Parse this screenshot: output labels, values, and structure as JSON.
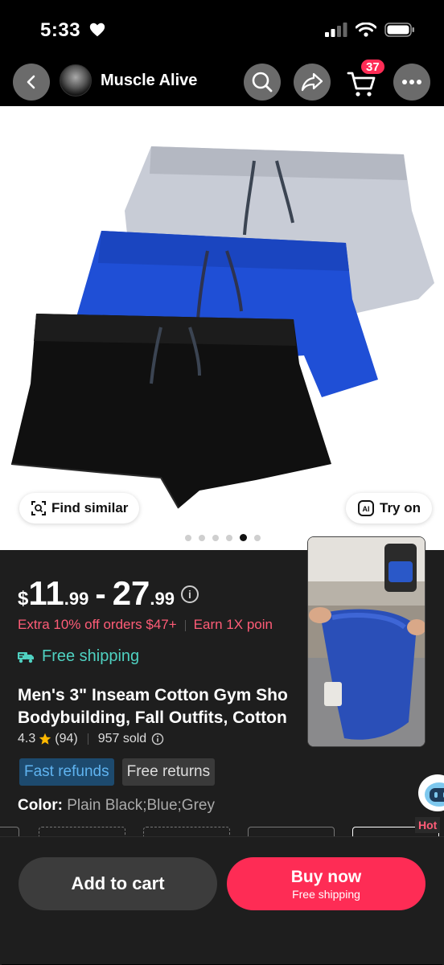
{
  "status_bar": {
    "time": "5:33"
  },
  "nav": {
    "shop_name": "Muscle Alive",
    "cart_count": "37"
  },
  "hero": {
    "find_similar": "Find similar",
    "try_on": "Try on",
    "carousel": {
      "total": 6,
      "active_index": 4
    }
  },
  "product": {
    "price": {
      "currency": "$",
      "low_main": "11",
      "low_cents": ".99",
      "dash": "-",
      "high_main": "27",
      "high_cents": ".99"
    },
    "promo": "Extra 10% off orders $47+",
    "points": "Earn 1X poin",
    "shipping": "Free shipping",
    "title_line1": "Men's 3\" Inseam Cotton Gym Sho",
    "title_line2": "Bodybuilding, Fall Outfits, Cotton",
    "rating": "4.3",
    "reviews": "(94)",
    "sold": "957 sold",
    "badges": [
      "Fast refunds",
      "Free returns"
    ],
    "color_label": "Color:",
    "color_value": "Plain Black;Blue;Grey"
  },
  "floating": {
    "hot_label": "Hot"
  },
  "bottom_bar": {
    "add_to_cart": "Add to cart",
    "buy_now": "Buy now",
    "buy_now_sub": "Free shipping"
  },
  "colors": {
    "accent": "#fe2c55",
    "teal": "#4fd1c1",
    "promo": "#ff5c77",
    "panel": "#1e1e1e"
  }
}
